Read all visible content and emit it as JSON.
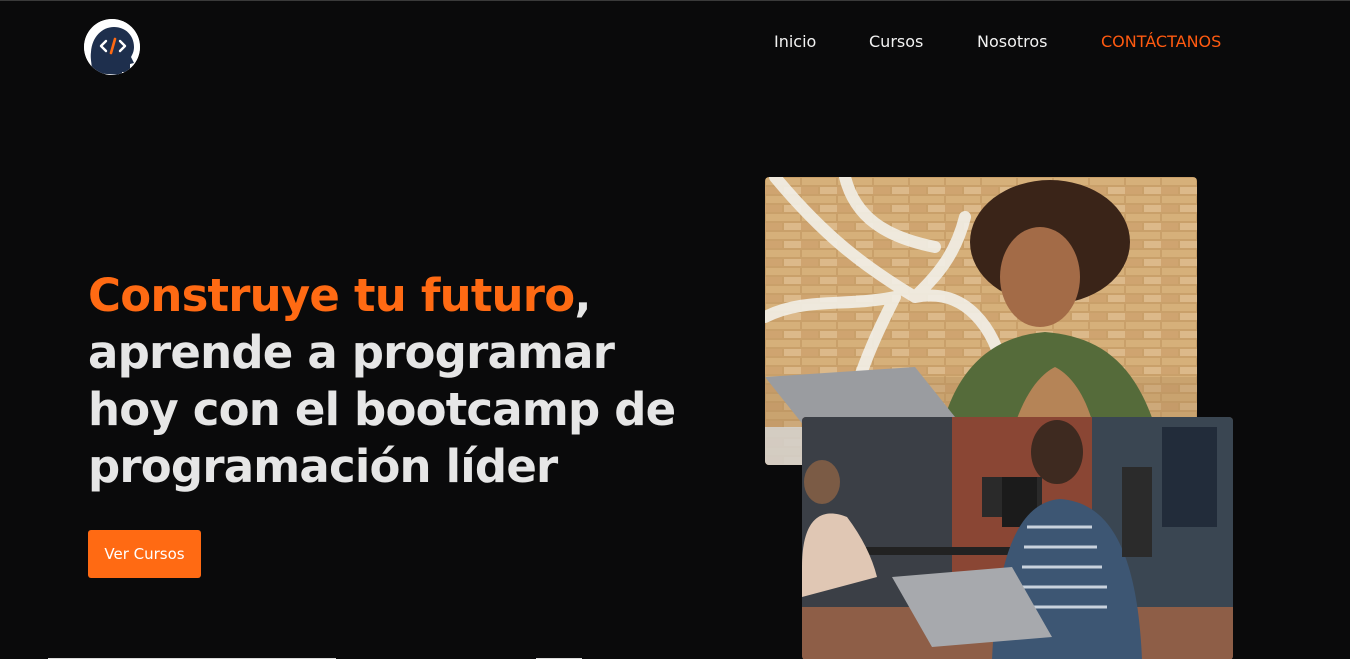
{
  "header": {
    "logo_icon": "code-head-logo-icon",
    "nav": [
      {
        "label": "Inicio"
      },
      {
        "label": "Cursos"
      },
      {
        "label": "Nosotros"
      },
      {
        "label": "CONTÁCTANOS"
      }
    ]
  },
  "hero": {
    "headline_accent": "Construye tu futuro",
    "headline_comma": ",",
    "headline_rest": "aprende a programar hoy con el bootcamp de programación líder",
    "cta_label": "Ver Cursos"
  },
  "images": [
    {
      "icon": "woman-at-laptop-photo"
    },
    {
      "icon": "man-with-laptop-office-photo"
    }
  ],
  "colors": {
    "background": "#0a0a0b",
    "accent": "#ff6a13",
    "text": "#e6e6e6"
  }
}
